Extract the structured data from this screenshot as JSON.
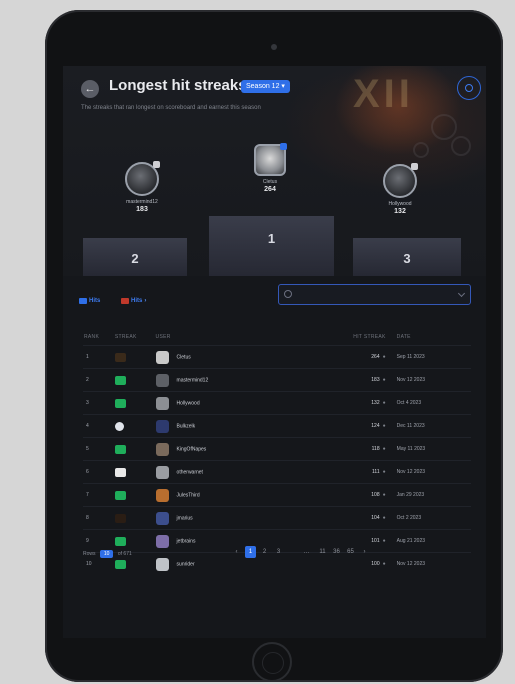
{
  "header": {
    "title": "Longest hit streaks",
    "badge": "Season 12 ▾",
    "subtitle": "The streaks that ran longest on scoreboard and earnest this season"
  },
  "decor": {
    "season_mark": "XII"
  },
  "podium": [
    {
      "place": "2",
      "name": "mastermind12",
      "score": "183"
    },
    {
      "place": "1",
      "name": "Cletus",
      "score": "264"
    },
    {
      "place": "3",
      "name": "Hollywood",
      "score": "132"
    }
  ],
  "tabs": [
    {
      "label": "Hits"
    },
    {
      "label": "Hits"
    }
  ],
  "search": {
    "placeholder": "",
    "value": ""
  },
  "table": {
    "headers": [
      "RANK",
      "STREAK",
      "USER",
      "HIT STREAK",
      "DATE"
    ],
    "unit": "●",
    "rows": [
      {
        "rank": "1",
        "user": "Cletus",
        "hits": "264",
        "date": "Sep 11 2023"
      },
      {
        "rank": "2",
        "user": "mastermind12",
        "hits": "183",
        "date": "Nov 12 2023"
      },
      {
        "rank": "3",
        "user": "Hollywood",
        "hits": "132",
        "date": "Oct 4 2023"
      },
      {
        "rank": "4",
        "user": "Bulkzelk",
        "hits": "124",
        "date": "Dec 11 2023"
      },
      {
        "rank": "5",
        "user": "KingOfNapes",
        "hits": "118",
        "date": "May 11 2023"
      },
      {
        "rank": "6",
        "user": "otherwarnet",
        "hits": "111",
        "date": "Nov 12 2023"
      },
      {
        "rank": "7",
        "user": "JulesThird",
        "hits": "108",
        "date": "Jan 29 2023"
      },
      {
        "rank": "8",
        "user": "jmarius",
        "hits": "104",
        "date": "Oct 2 2023"
      },
      {
        "rank": "9",
        "user": "jetbrains",
        "hits": "101",
        "date": "Aug 21 2023"
      },
      {
        "rank": "10",
        "user": "sunrider",
        "hits": "100",
        "date": "Nov 12 2023"
      }
    ]
  },
  "footer": {
    "rows_label": "Rows",
    "rows_value": "10",
    "rows_suffix": "of 671",
    "pages": [
      "‹",
      "1",
      "2",
      "3",
      "…",
      "11",
      "36",
      "65",
      "›"
    ],
    "active_page": "1"
  },
  "colors": {
    "accent": "#2f6fe8",
    "screen_bg": "#15171b"
  }
}
